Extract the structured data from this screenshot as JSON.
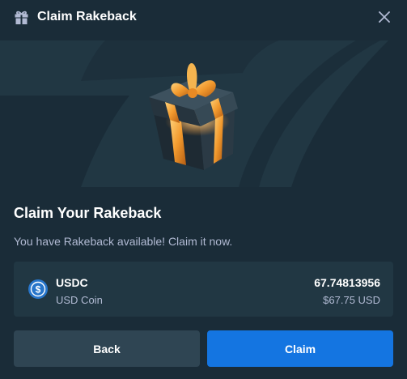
{
  "header": {
    "title": "Claim Rakeback",
    "icon": "gift-icon",
    "close_icon": "close-icon"
  },
  "banner": {
    "image": "gift-box-illustration"
  },
  "main": {
    "heading": "Claim Your Rakeback",
    "subtitle": "You have Rakeback available! Claim it now."
  },
  "coin": {
    "symbol": "USDC",
    "name": "USD Coin",
    "amount": "67.74813956",
    "usd_value": "$67.75 USD",
    "icon": "usdc-icon",
    "color": "#2775ca"
  },
  "buttons": {
    "back_label": "Back",
    "claim_label": "Claim"
  },
  "colors": {
    "background": "#1a2c38",
    "card": "#213743",
    "back_button": "#2f4553",
    "claim_button": "#1475e1"
  }
}
